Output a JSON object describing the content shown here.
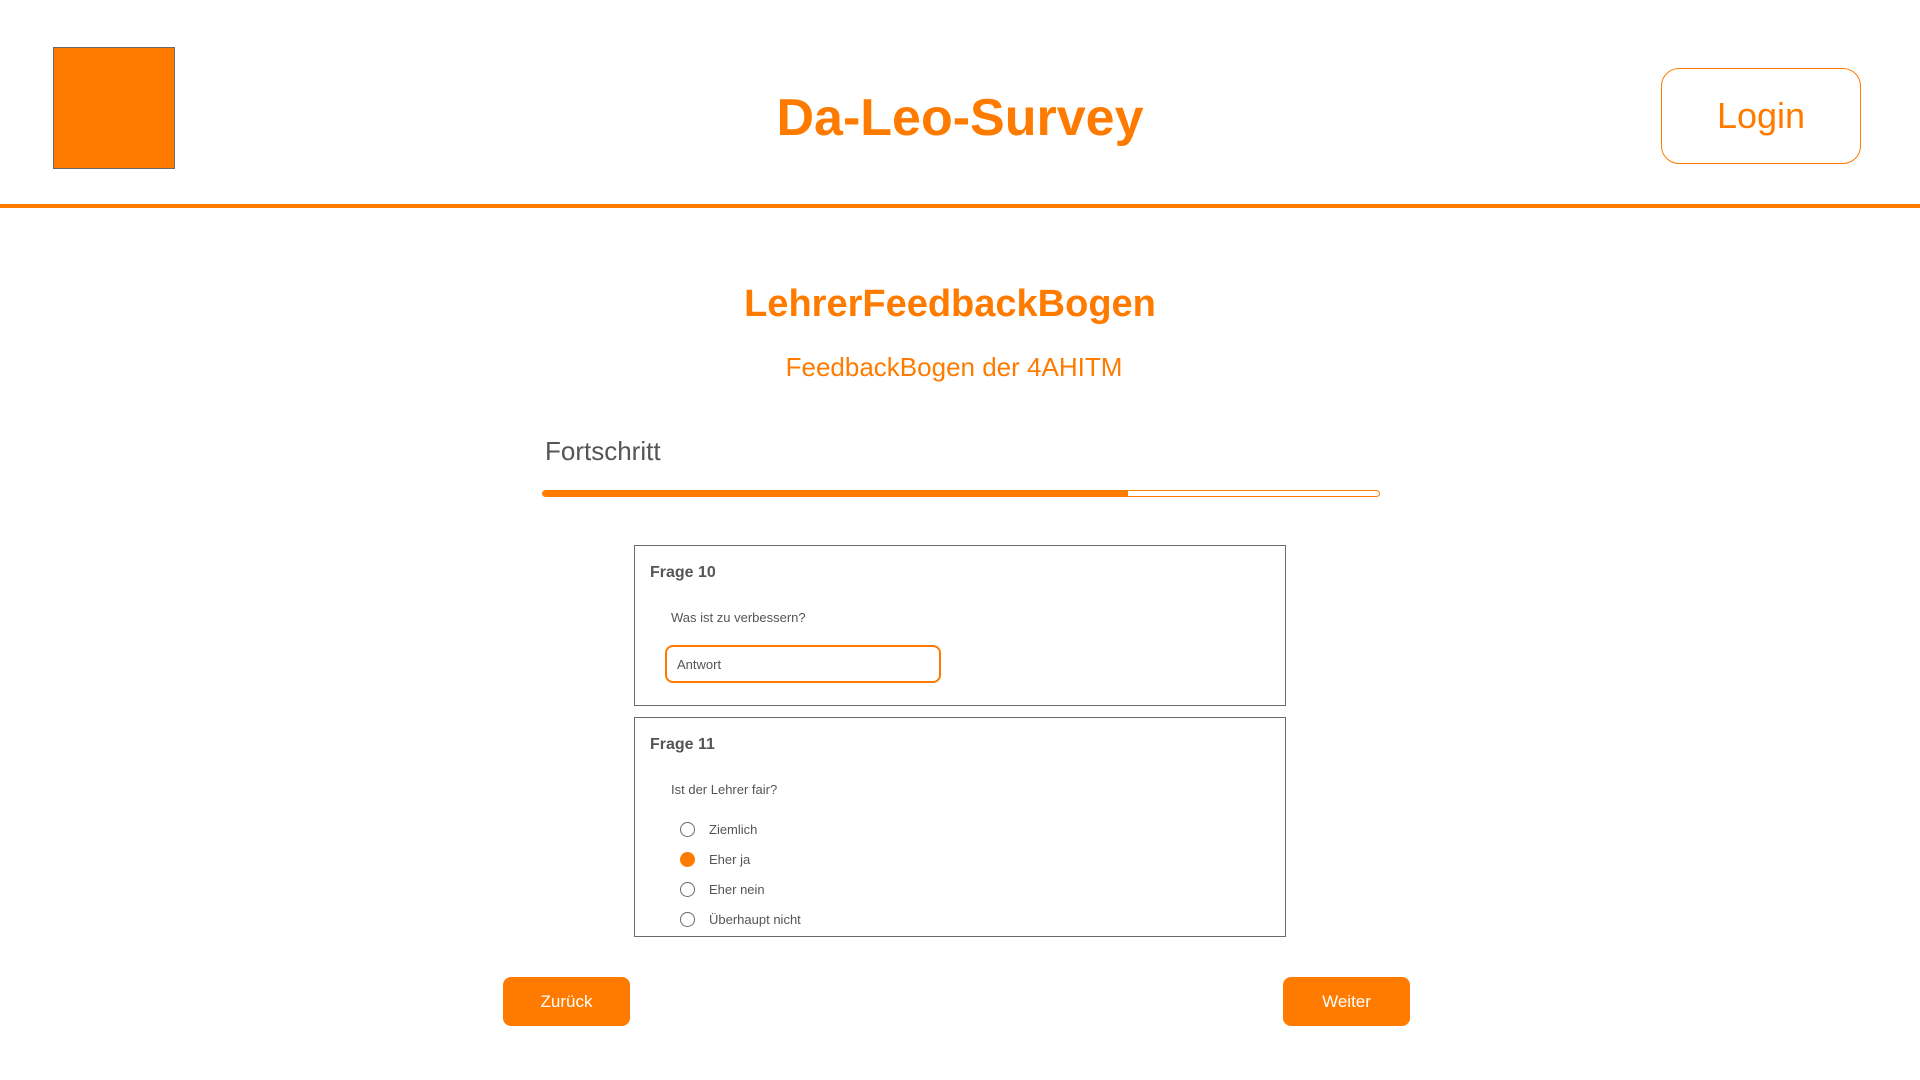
{
  "header": {
    "app_title": "Da-Leo-Survey",
    "login_label": "Login"
  },
  "survey": {
    "title": "LehrerFeedbackBogen",
    "subtitle": "FeedbackBogen der 4AHITM"
  },
  "progress": {
    "label": "Fortschritt",
    "percent": 70
  },
  "questions": [
    {
      "number": "Frage 10",
      "text": "Was ist zu verbessern?",
      "type": "text",
      "placeholder": "Antwort",
      "value": ""
    },
    {
      "number": "Frage 11",
      "text": "Ist der Lehrer fair?",
      "type": "radio",
      "options": [
        "Ziemlich",
        "Eher ja",
        "Eher nein",
        "Überhaupt nicht"
      ],
      "selected": "Eher ja"
    }
  ],
  "navigation": {
    "back_label": "Zurück",
    "next_label": "Weiter"
  },
  "colors": {
    "accent": "#ff7b00",
    "text_muted": "#555555",
    "border": "#6b6b6b"
  }
}
